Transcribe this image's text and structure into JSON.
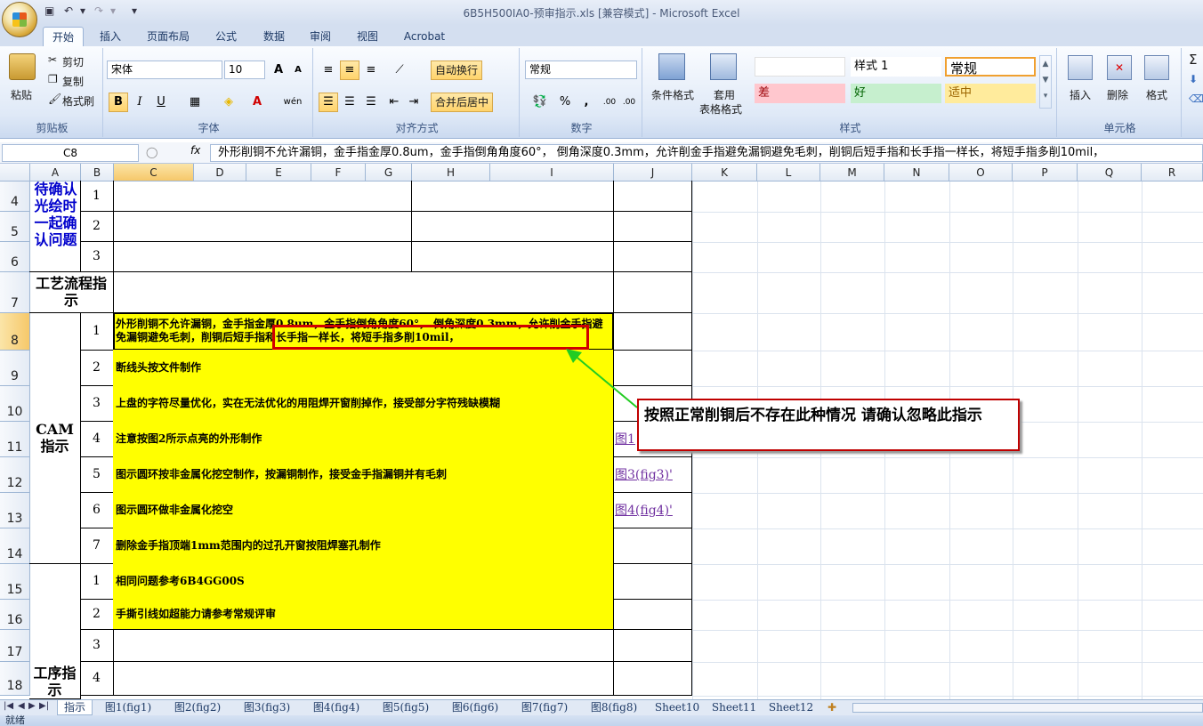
{
  "window": {
    "title": "6B5H500IA0-预审指示.xls  [兼容模式] - Microsoft Excel",
    "qat_more": "▾"
  },
  "tabs": [
    "开始",
    "插入",
    "页面布局",
    "公式",
    "数据",
    "审阅",
    "视图",
    "Acrobat"
  ],
  "ribbon": {
    "clipboard": {
      "paste": "粘贴",
      "cut": "剪切",
      "copy": "复制",
      "format_painter": "格式刷",
      "label": "剪贴板"
    },
    "font": {
      "name": "宋体",
      "size": "10",
      "grow": "A",
      "shrink": "A",
      "bold": "B",
      "italic": "I",
      "underline": "U",
      "phonetic": "wén",
      "label": "字体"
    },
    "alignment": {
      "wrap": "自动换行",
      "merge": "合并后居中",
      "label": "对齐方式"
    },
    "number": {
      "format": "常规",
      "percent": "%",
      "comma": ",",
      "inc": ".00",
      "dec": ".00",
      "label": "数字"
    },
    "styles": {
      "conditional": "条件格式",
      "table1": "套用",
      "table2": "表格格式",
      "style1": "样式 1",
      "normal": "常规",
      "bad": "差",
      "good": "好",
      "neutral": "适中",
      "label": "样式"
    },
    "cells": {
      "insert": "插入",
      "delete": "删除",
      "format": "格式",
      "label": "单元格"
    },
    "editing": {
      "sum": "Σ"
    }
  },
  "formula_bar": {
    "name_box": "C8",
    "fx": "fx",
    "content": "外形削铜不允许漏铜，金手指金厚0.8um，金手指倒角角度60°，  倒角深度0.3mm，允许削金手指避免漏铜避免毛刺，削铜后短手指和长手指一样长，将短手指多削10mil，"
  },
  "columns": [
    "A",
    "B",
    "C",
    "D",
    "E",
    "F",
    "G",
    "H",
    "I",
    "J",
    "K",
    "L",
    "M",
    "N",
    "O",
    "P",
    "Q",
    "R"
  ],
  "rows": [
    "4",
    "5",
    "6",
    "7",
    "8",
    "9",
    "10",
    "11",
    "12",
    "13",
    "14",
    "15",
    "16",
    "17",
    "18"
  ],
  "sheet": {
    "section_confirm": "待确认光绘时一起确认问题",
    "section_process": "工艺流程指示",
    "section_cam": "CAM指示",
    "section_ops": "工序指示",
    "confirm_nums": [
      "1",
      "2",
      "3"
    ],
    "cam_items": [
      {
        "n": "1",
        "text": "外形削铜不允许漏铜，金手指金厚0.8um，金手指倒角角度60°，  倒角深度0.3mm，允许削金手指避免漏铜避免毛刺，削铜后短手指和长手指一样长，将短手指多削10mil，",
        "link": ""
      },
      {
        "n": "2",
        "text": "断线头按文件制作",
        "link": ""
      },
      {
        "n": "3",
        "text": "上盘的字符尽量优化，实在无法优化的用阻焊开窗削掉作，接受部分字符残缺模糊",
        "link": ""
      },
      {
        "n": "4",
        "text": "注意按图2所示点亮的外形制作",
        "link": "图1"
      },
      {
        "n": "5",
        "text": "图示圆环按非金属化挖空制作，按漏铜制作，接受金手指漏铜并有毛刺",
        "link": "图3(fig3)'"
      },
      {
        "n": "6",
        "text": "图示圆环做非金属化挖空",
        "link": "图4(fig4)'"
      },
      {
        "n": "7",
        "text": "删除金手指顶端1mm范围内的过孔开窗按阻焊塞孔制作",
        "link": ""
      }
    ],
    "ops_items": [
      {
        "n": "1",
        "text": "相同问题参考6B4GG00S"
      },
      {
        "n": "2",
        "text": "手撕引线如超能力请参考常规评审"
      },
      {
        "n": "3",
        "text": ""
      },
      {
        "n": "4",
        "text": ""
      }
    ]
  },
  "annotation": {
    "callout": "按照正常削铜后不存在此种情况  请确认忽略此指示"
  },
  "sheet_tabs": [
    "指示",
    "图1(fig1)",
    "图2(fig2)",
    "图3(fig3)",
    "图4(fig4)",
    "图5(fig5)",
    "图6(fig6)",
    "图7(fig7)",
    "图8(fig8)",
    "Sheet10",
    "Sheet11",
    "Sheet12"
  ],
  "status": "就绪",
  "colors": {
    "highlight": "#ffff00",
    "callout_border": "#c00000",
    "arrow": "#22cc22"
  }
}
